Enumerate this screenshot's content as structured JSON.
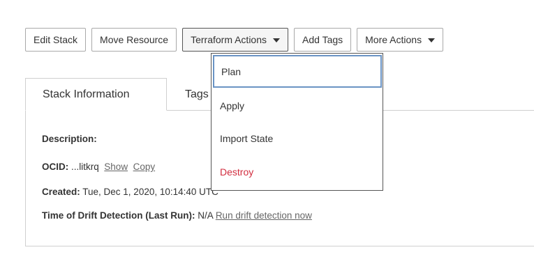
{
  "toolbar": {
    "edit_stack": "Edit Stack",
    "move_resource": "Move Resource",
    "terraform_actions": "Terraform Actions",
    "add_tags": "Add Tags",
    "more_actions": "More Actions"
  },
  "tabs": [
    {
      "label": "Stack Information"
    },
    {
      "label": "Tags"
    }
  ],
  "info": {
    "description_label": "Description:",
    "description_value": "",
    "ocid_label": "OCID:",
    "ocid_value": "...litkrq",
    "ocid_show": "Show",
    "ocid_copy": "Copy",
    "created_label": "Created:",
    "created_value": "Tue, Dec 1, 2020, 10:14:40 UTC",
    "drift_label": "Time of Drift Detection (Last Run):",
    "drift_value": "N/A",
    "drift_link": "Run drift detection now"
  },
  "terraform_menu": {
    "items": [
      {
        "label": "Plan"
      },
      {
        "label": "Apply"
      },
      {
        "label": "Import State"
      },
      {
        "label": "Destroy"
      }
    ]
  },
  "colors": {
    "danger": "#d22d3f",
    "focus_ring": "#6a93c4",
    "border": "#cfcfcf",
    "link": "#666666"
  },
  "icons": {
    "caret": "caret-down-icon"
  }
}
